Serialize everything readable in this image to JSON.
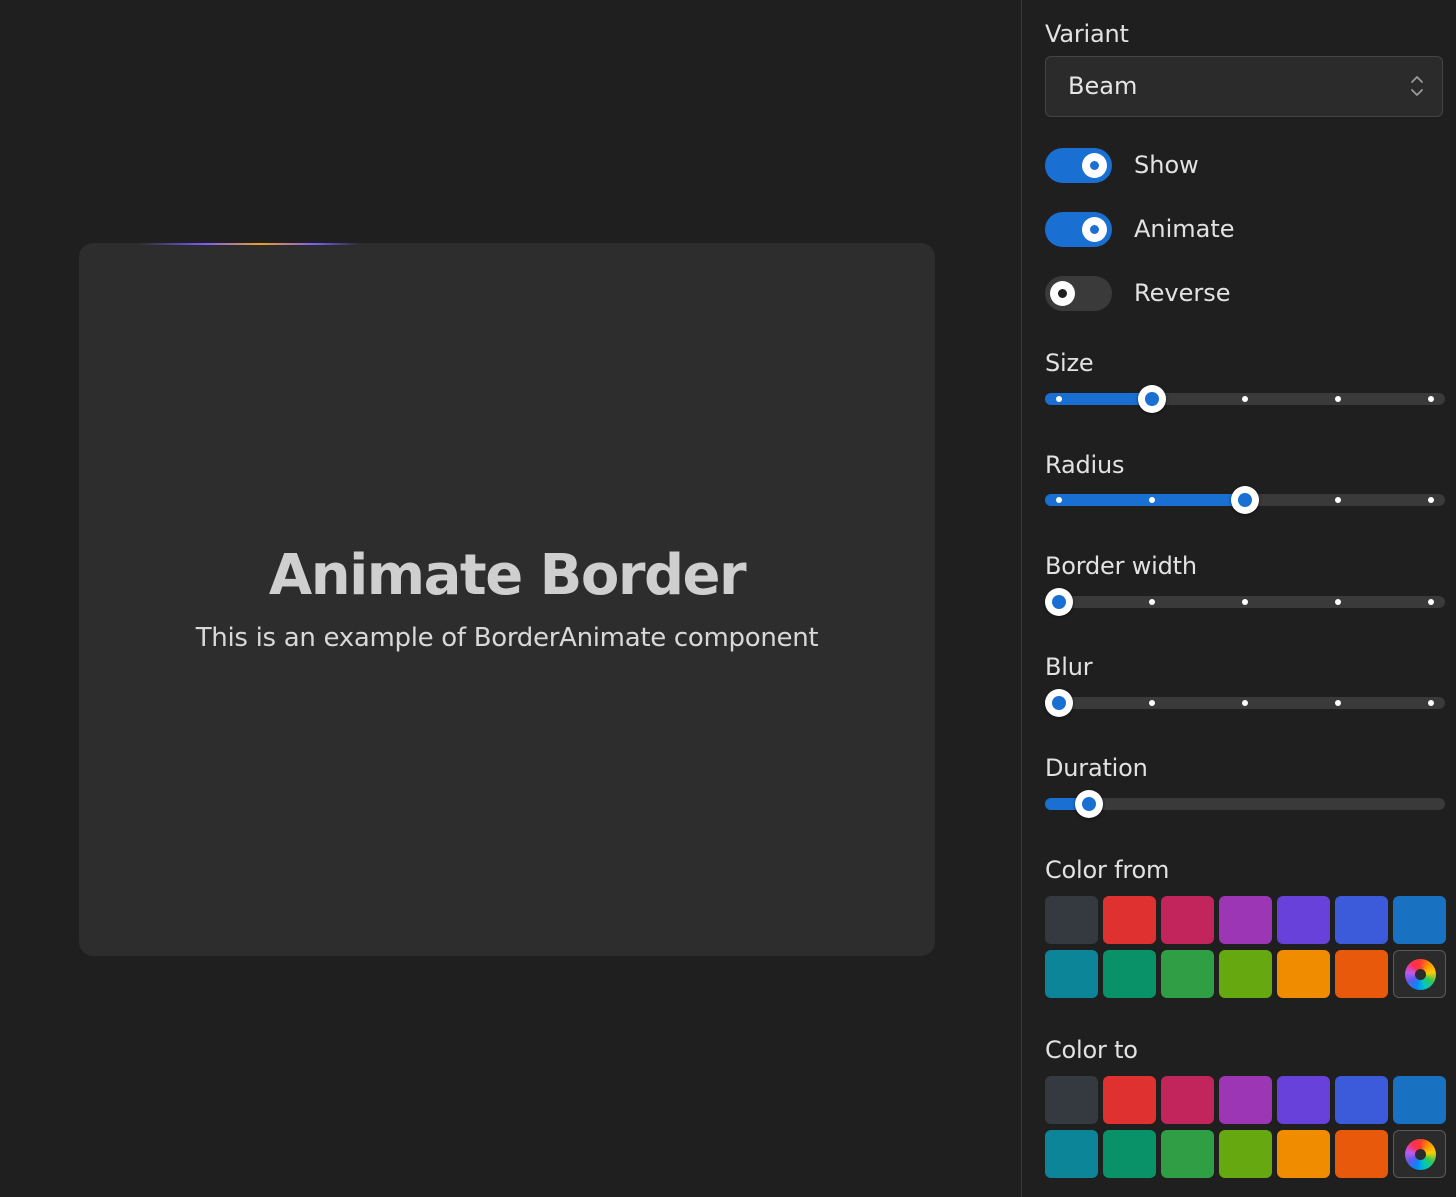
{
  "preview": {
    "title": "Animate Border",
    "subtitle": "This is an example of BorderAnimate component"
  },
  "controls": {
    "variant": {
      "label": "Variant",
      "value": "Beam"
    },
    "toggles": [
      {
        "label": "Show",
        "on": true
      },
      {
        "label": "Animate",
        "on": true
      },
      {
        "label": "Reverse",
        "on": false
      }
    ],
    "sliders": [
      {
        "label": "Size",
        "value_fraction": 0.25,
        "steps": 5
      },
      {
        "label": "Radius",
        "value_fraction": 0.5,
        "steps": 5
      },
      {
        "label": "Border width",
        "value_fraction": 0.0,
        "steps": 5
      },
      {
        "label": "Blur",
        "value_fraction": 0.0,
        "steps": 5
      },
      {
        "label": "Duration",
        "value_fraction": 0.08,
        "steps": 0
      }
    ],
    "color_from": {
      "label": "Color from"
    },
    "color_to": {
      "label": "Color to"
    },
    "palette": [
      "#343a40",
      "#e03131",
      "#c2255c",
      "#9c36b5",
      "#6741d9",
      "#3b5bdb",
      "#1971c2",
      "#0c8599",
      "#099268",
      "#2f9e44",
      "#66a80f",
      "#f08c00",
      "#e8590c"
    ]
  },
  "colors": {
    "accent": "#1a6fd2",
    "card_bg": "#2d2d2d",
    "page_bg": "#1f1f1f"
  }
}
